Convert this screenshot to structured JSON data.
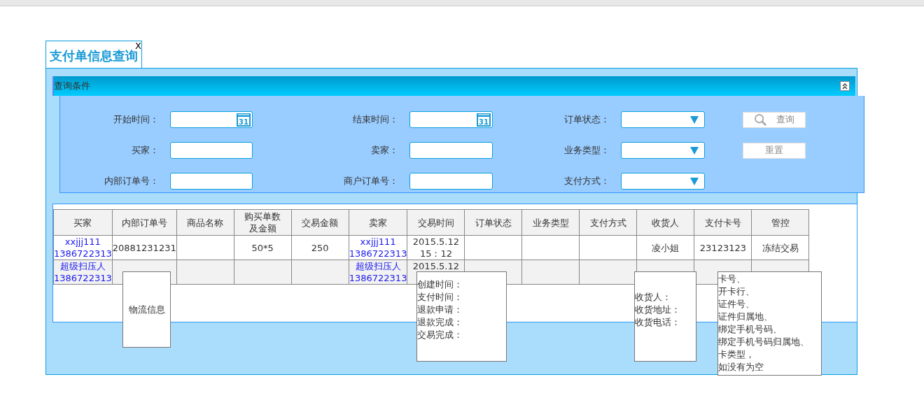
{
  "tab": {
    "title": "支付单信息查询",
    "close": "X"
  },
  "query_panel": {
    "title": "查询条件",
    "rows": [
      {
        "fields": [
          {
            "label": "开始时间：",
            "kind": "date",
            "icon_text": "31"
          },
          {
            "label": "结束时间：",
            "kind": "date",
            "icon_text": "31"
          },
          {
            "label": "订单状态：",
            "kind": "select"
          }
        ],
        "button": {
          "label": "查询",
          "kind": "search"
        }
      },
      {
        "fields": [
          {
            "label": "买家：",
            "kind": "text"
          },
          {
            "label": "卖家：",
            "kind": "text"
          },
          {
            "label": "业务类型：",
            "kind": "select"
          }
        ],
        "button": {
          "label": "重置",
          "kind": "plain"
        }
      },
      {
        "fields": [
          {
            "label": "内部订单号：",
            "kind": "text"
          },
          {
            "label": "商户订单号：",
            "kind": "text"
          },
          {
            "label": "支付方式：",
            "kind": "select"
          }
        ]
      }
    ]
  },
  "table": {
    "columns": [
      "买家",
      "内部订单号",
      "商品名称",
      "购买单数及金额",
      "交易金额",
      "卖家",
      "交易时间",
      "订单状态",
      "业务类型",
      "支付方式",
      "收货人",
      "支付卡号",
      "管控"
    ],
    "rows": [
      {
        "cells": [
          {
            "kind": "link",
            "text": "xxjjj111\n1386722313"
          },
          {
            "kind": "text",
            "text": "20881231231"
          },
          {
            "kind": "empty"
          },
          {
            "kind": "text",
            "text": "50*5"
          },
          {
            "kind": "text",
            "text": "250"
          },
          {
            "kind": "link",
            "text": "xxjjj111\n1386722313"
          },
          {
            "kind": "text",
            "text": "2015.5.12\n15：12"
          },
          {
            "kind": "empty"
          },
          {
            "kind": "empty"
          },
          {
            "kind": "empty"
          },
          {
            "kind": "text",
            "text": "凌小姐"
          },
          {
            "kind": "text",
            "text": "23123123"
          },
          {
            "kind": "text",
            "text": "冻结交易"
          }
        ]
      },
      {
        "cells": [
          {
            "kind": "link",
            "text": "超级扫压人\n1386722313"
          },
          {
            "kind": "empty"
          },
          {
            "kind": "empty"
          },
          {
            "kind": "empty"
          },
          {
            "kind": "empty"
          },
          {
            "kind": "link",
            "text": "超级扫压人\n1386722313"
          },
          {
            "kind": "top",
            "text": "2015.5.12"
          },
          {
            "kind": "empty"
          },
          {
            "kind": "empty"
          },
          {
            "kind": "empty"
          },
          {
            "kind": "empty"
          },
          {
            "kind": "empty"
          },
          {
            "kind": "empty"
          }
        ]
      }
    ]
  },
  "popups": [
    {
      "kind": "center",
      "lines": [
        "物流信息"
      ]
    },
    {
      "kind": "list",
      "lines": [
        "创建时间：",
        "支付时间：",
        "退款申请：",
        "退款完成：",
        "交易完成："
      ]
    },
    {
      "kind": "list",
      "lines": [
        "收货人：",
        "收货地址：",
        "收货电话："
      ]
    },
    {
      "kind": "top",
      "lines": [
        "卡号、",
        "开卡行、",
        "证件号、",
        "证件归属地、",
        "绑定手机号码、",
        "绑定手机号码归属地、",
        "卡类型，",
        "如没有为空"
      ]
    }
  ]
}
